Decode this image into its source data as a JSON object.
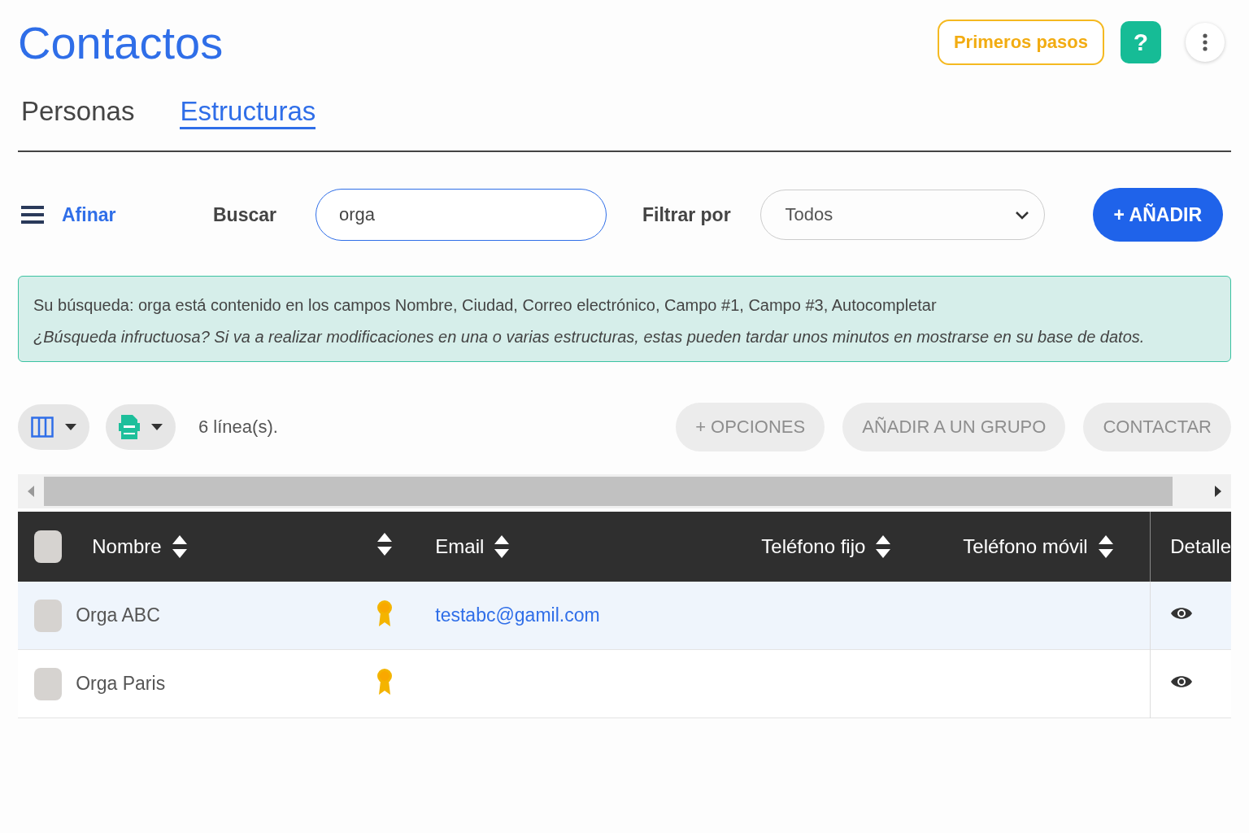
{
  "header": {
    "title": "Contactos",
    "guide_button": "Primeros pasos",
    "help_button": "?"
  },
  "tabs": [
    {
      "label": "Personas",
      "selected": false
    },
    {
      "label": "Estructuras",
      "selected": true
    }
  ],
  "toolbar": {
    "refine": "Afinar",
    "search_label": "Buscar",
    "search_value": "orga",
    "filter_label": "Filtrar por",
    "filter_value": "Todos",
    "add_button": "+ AÑADIR"
  },
  "info": {
    "line_1": "Su búsqueda: orga está contenido en los campos Nombre, Ciudad, Correo electrónico, Campo #1, Campo #3, Autocompletar",
    "line_2": "¿Búsqueda infructuosa? Si va a realizar modificaciones en una o varias estructuras, estas pueden tardar unos minutos en mostrarse en su base de datos."
  },
  "actions": {
    "count": "6 línea(s).",
    "buttons": [
      {
        "label": "+ OPCIONES",
        "disabled": true
      },
      {
        "label": "AÑADIR A UN GRUPO",
        "disabled": true
      },
      {
        "label": "CONTACTAR",
        "disabled": true
      }
    ]
  },
  "table": {
    "all_checked": false,
    "columns": [
      {
        "label": "Nombre",
        "sortable": true
      },
      {
        "sortable": true
      },
      {
        "label": "Email",
        "sortable": true
      },
      {
        "label": "Teléfono fijo",
        "sortable": true
      },
      {
        "label": "Teléfono móvil",
        "sortable": true
      },
      {
        "label": "Detalle",
        "sortable": false
      }
    ],
    "rows": [
      {
        "checked": false,
        "highlighted": true,
        "name": "Orga ABC",
        "email": "testabc@gamil.com"
      },
      {
        "checked": false,
        "highlighted": false,
        "name": "Orga Paris"
      }
    ]
  }
}
